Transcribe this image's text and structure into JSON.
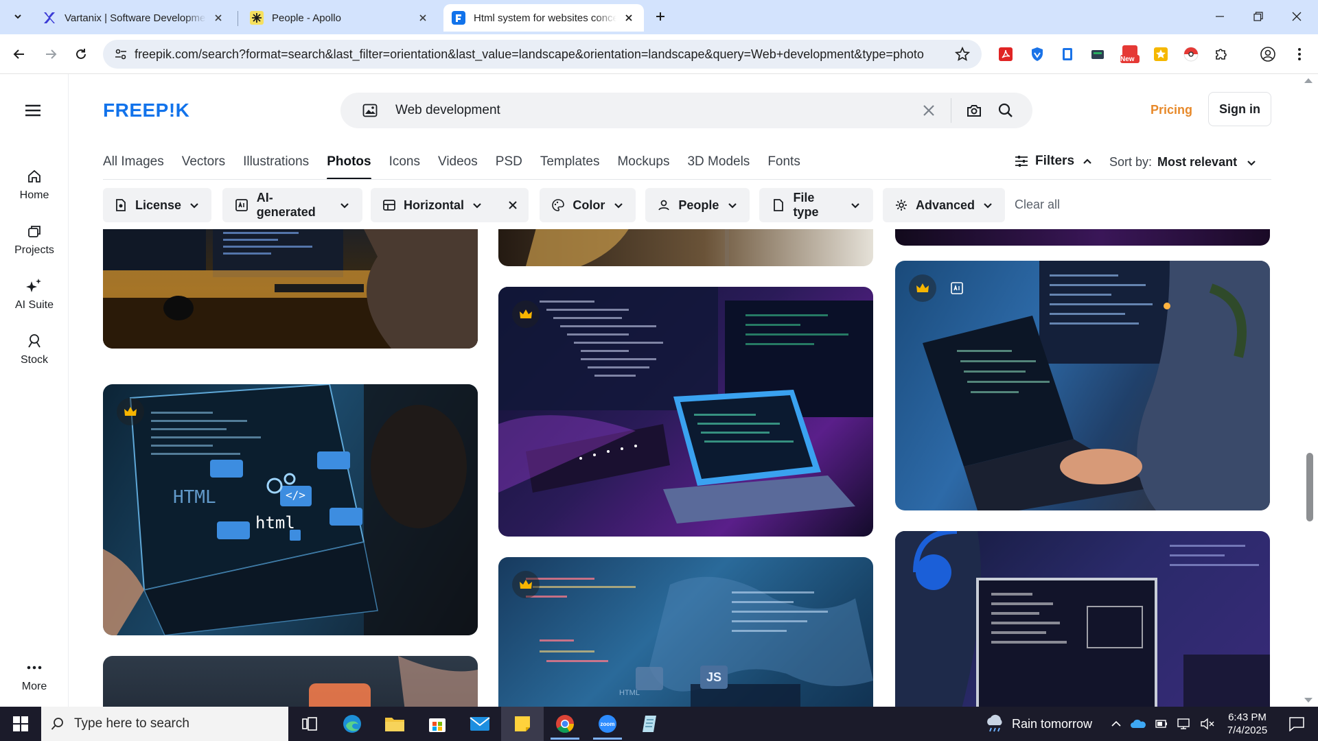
{
  "browser": {
    "tabs": [
      {
        "title": "Vartanix | Software Developmen",
        "active": false
      },
      {
        "title": "People - Apollo",
        "active": false
      },
      {
        "title": "Html system for websites conce",
        "active": true
      }
    ],
    "url": "freepik.com/search?format=search&last_filter=orientation&last_value=landscape&orientation=landscape&query=Web+development&type=photo",
    "extensions": [
      "pdf-icon",
      "shield-icon",
      "file-icon",
      "device-icon",
      "new-badge-extension-icon",
      "star-extension-icon",
      "pokeball-icon",
      "puzzle-icon"
    ],
    "new_badge": "New"
  },
  "site": {
    "logo": "FREEPIK",
    "search_query": "Web development",
    "pricing": "Pricing",
    "signin": "Sign in",
    "rail": [
      {
        "label": "Home",
        "icon": "home-icon"
      },
      {
        "label": "Projects",
        "icon": "projects-icon"
      },
      {
        "label": "AI Suite",
        "icon": "ai-suite-icon"
      },
      {
        "label": "Stock",
        "icon": "stock-icon"
      },
      {
        "label": "More",
        "icon": "more-icon"
      }
    ],
    "categories": [
      "All Images",
      "Vectors",
      "Illustrations",
      "Photos",
      "Icons",
      "Videos",
      "PSD",
      "Templates",
      "Mockups",
      "3D Models",
      "Fonts"
    ],
    "active_category": "Photos",
    "filters_label": "Filters",
    "sort_label": "Sort by:",
    "sort_value": "Most relevant",
    "chips": [
      {
        "label": "License",
        "icon": "license-icon"
      },
      {
        "label": "AI-generated",
        "icon": "ai-generated-icon"
      },
      {
        "label": "Horizontal",
        "icon": "horizontal-icon"
      },
      {
        "label": "Color",
        "icon": "palette-icon"
      },
      {
        "label": "People",
        "icon": "people-icon"
      },
      {
        "label": "File type",
        "icon": "file-type-icon"
      },
      {
        "label": "Advanced",
        "icon": "gear-icon"
      }
    ],
    "clear_all": "Clear all"
  },
  "photo_labels": {
    "html_big": "HTML",
    "html_small": "html",
    "html_tag": "HTML",
    "js": "JS",
    "code_tag": "</>"
  },
  "taskbar": {
    "search_placeholder": "Type here to search",
    "weather": "Rain tomorrow",
    "time": "6:43 PM",
    "date": "7/4/2025",
    "zoom": "zoom"
  },
  "colors": {
    "tabstrip": "#d3e3fd",
    "freepik_blue": "#1273eb",
    "pricing_orange": "#e7892a",
    "taskbar": "#1b1b2a"
  }
}
